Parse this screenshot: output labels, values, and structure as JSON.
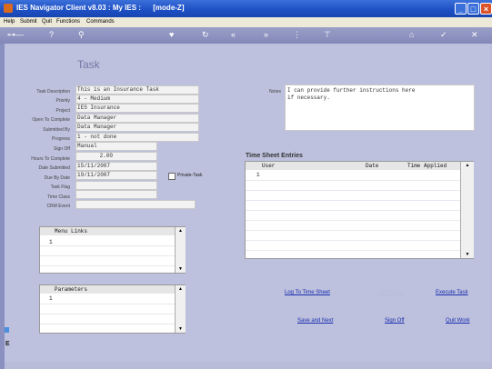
{
  "window": {
    "title": "IES Navigator Client v8.03 : My IES :      [mode-Z]"
  },
  "menu": [
    "Help",
    "Submit",
    "Quit",
    "Functions",
    "Commands"
  ],
  "task": {
    "heading": "Task",
    "fields": [
      {
        "label": "Task Description",
        "value": "This is an Insurance Task"
      },
      {
        "label": "Priority",
        "value": "4 - Medium"
      },
      {
        "label": "Project",
        "value": "IES Insurance"
      },
      {
        "label": "Open To Complete",
        "value": "Data Manager"
      },
      {
        "label": "Submitted By",
        "value": "Data Manager"
      },
      {
        "label": "Progress",
        "value": "1 - not done"
      },
      {
        "label": "Sign Off",
        "value": "Manual"
      },
      {
        "label": "Hours To Complete",
        "value": "2.00"
      },
      {
        "label": "Date Submitted",
        "value": "15/11/2007"
      },
      {
        "label": "Due By Date",
        "value": "19/11/2007"
      },
      {
        "label": "Task Flag",
        "value": ""
      },
      {
        "label": "Time Class",
        "value": ""
      },
      {
        "label": "CRM Event",
        "value": ""
      }
    ],
    "private_task_label": "Private-Task"
  },
  "notes": {
    "label": "Notes",
    "text": "I can provide further instructions here\nif necessary."
  },
  "time_sheet": {
    "title": "Time Sheet Entries",
    "columns": [
      "User",
      "Date",
      "Time Applied"
    ],
    "first_row_num": "1"
  },
  "menu_links": {
    "title": "Menu Links",
    "first_row_num": "1"
  },
  "parameters": {
    "title": "Parameters",
    "first_row_num": "1"
  },
  "actions": {
    "log_time": "Log To Time Sheet",
    "crm_event": "CRM Event",
    "execute_task": "Execute Task",
    "save_next": "Save and Next",
    "sign_off": "Sign Off",
    "quit_work": "Quit Work"
  }
}
